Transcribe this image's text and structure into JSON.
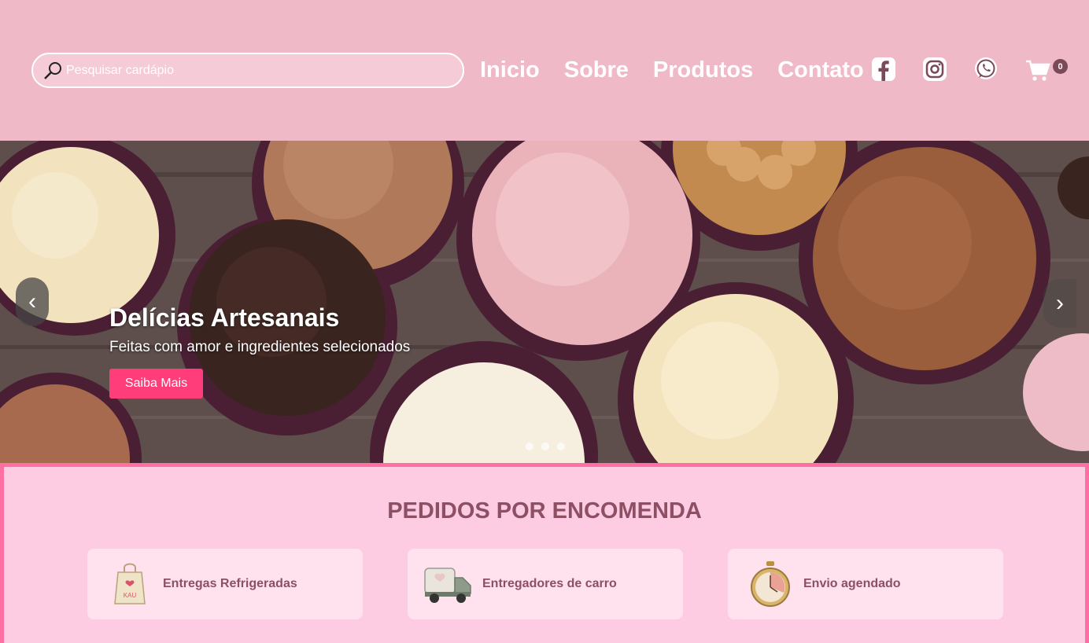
{
  "search": {
    "placeholder": "Pesquisar cardápio"
  },
  "nav": [
    "Inicio",
    "Sobre",
    "Produtos",
    "Contato"
  ],
  "social": [
    "facebook-icon",
    "instagram-icon",
    "whatsapp-icon"
  ],
  "cart": {
    "count": "0"
  },
  "hero": {
    "title": "Delícias Artesanais",
    "subtitle": "Feitas com amor e ingredientes selecionados",
    "button": "Saiba Mais",
    "prev": "‹",
    "next": "›",
    "slides": 3
  },
  "section": {
    "title": "PEDIDOS POR ENCOMENDA",
    "cards": [
      {
        "label": "Entregas Refrigeradas",
        "icon": "bag-icon"
      },
      {
        "label": "Entregadores de carro",
        "icon": "truck-icon"
      },
      {
        "label": "Envio agendado",
        "icon": "stopwatch-icon"
      }
    ]
  },
  "colors": {
    "header": "#efb9c8",
    "accent": "#ff3d7a",
    "section_bg": "#fecce2",
    "section_border": "#ff6fa2",
    "text_dark": "#8c4f63"
  }
}
